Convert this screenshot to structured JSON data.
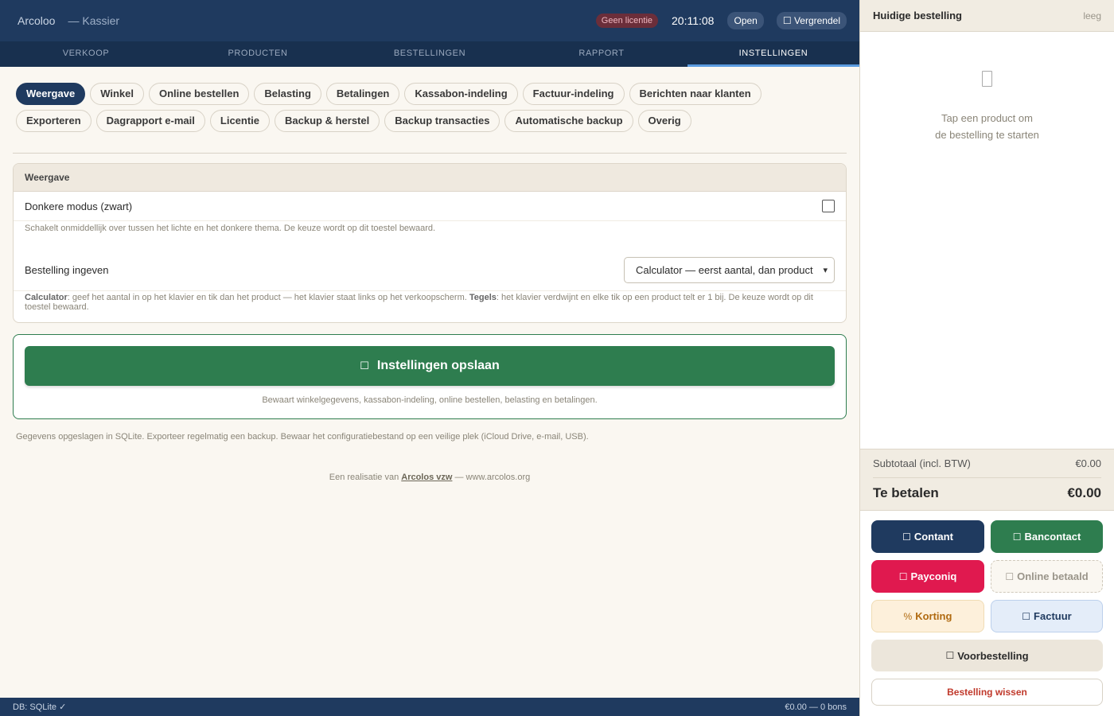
{
  "topbar": {
    "brand": "Arcoloo",
    "role": "— Kassier",
    "license_badge": "Geen licentie",
    "time": "20:11:08",
    "status": "Open",
    "lock_label": "Vergrendel",
    "lock_icon": "lock-icon"
  },
  "nav": {
    "tabs": [
      {
        "label": "VERKOOP"
      },
      {
        "label": "PRODUCTEN"
      },
      {
        "label": "BESTELLINGEN"
      },
      {
        "label": "RAPPORT"
      },
      {
        "label": "INSTELLINGEN"
      }
    ],
    "active": "INSTELLINGEN"
  },
  "settings_tabs": [
    {
      "label": "Weergave"
    },
    {
      "label": "Winkel"
    },
    {
      "label": "Online bestellen"
    },
    {
      "label": "Belasting"
    },
    {
      "label": "Betalingen"
    },
    {
      "label": "Kassabon-indeling"
    },
    {
      "label": "Factuur-indeling"
    },
    {
      "label": "Berichten naar klanten"
    },
    {
      "label": "Exporteren"
    },
    {
      "label": "Dagrapport e-mail"
    },
    {
      "label": "Licentie"
    },
    {
      "label": "Backup & herstel"
    },
    {
      "label": "Backup transacties"
    },
    {
      "label": "Automatische backup"
    },
    {
      "label": "Overig"
    }
  ],
  "weergave": {
    "header": "Weergave",
    "dark_mode_label": "Donkere modus (zwart)",
    "dark_mode_checked": false,
    "dark_mode_hint": "Schakelt onmiddellijk over tussen het lichte en het donkere thema. De keuze wordt op dit toestel bewaard.",
    "order_input_label": "Bestelling ingeven",
    "order_input_value": "Calculator — eerst aantal, dan product",
    "hint_calc_term": "Calculator",
    "hint_calc_text": ": geef het aantal in op het klavier en tik dan het product — het klavier staat links op het verkoopscherm. ",
    "hint_tiles_term": "Tegels",
    "hint_tiles_text": ": het klavier verdwijnt en elke tik op een product telt er 1 bij. De keuze wordt op dit toestel bewaard."
  },
  "save": {
    "label": "Instellingen opslaan",
    "icon": "save-icon",
    "note": "Bewaart winkelgegevens, kassabon-indeling, online bestellen, belasting en betalingen."
  },
  "storage_note": "Gegevens opgeslagen in SQLite. Exporteer regelmatig een backup. Bewaar het configuratiebestand op een veilige plek (iCloud Drive, e-mail, USB).",
  "credit": {
    "prefix": "Een realisatie van ",
    "org": "Arcolos vzw",
    "suffix": " — www.arcolos.org"
  },
  "statusbar": {
    "left": "DB: SQLite ✓",
    "right": "€0.00 — 0 bons"
  },
  "order": {
    "title": "Huidige bestelling",
    "status": "leeg",
    "empty_icon": "receipt-icon",
    "empty_line1": "Tap een product om",
    "empty_line2": "de bestelling te starten",
    "subtotal_label": "Subtotaal (incl. BTW)",
    "subtotal_value": "€0.00",
    "total_label": "Te betalen",
    "total_value": "€0.00",
    "buttons": {
      "cash": "Contant",
      "bancontact": "Bancontact",
      "payconiq": "Payconiq",
      "online": "Online betaald",
      "discount": "Korting",
      "discount_symbol": "%",
      "invoice": "Factuur",
      "preorder": "Voorbestelling",
      "clear": "Bestelling wissen"
    }
  }
}
